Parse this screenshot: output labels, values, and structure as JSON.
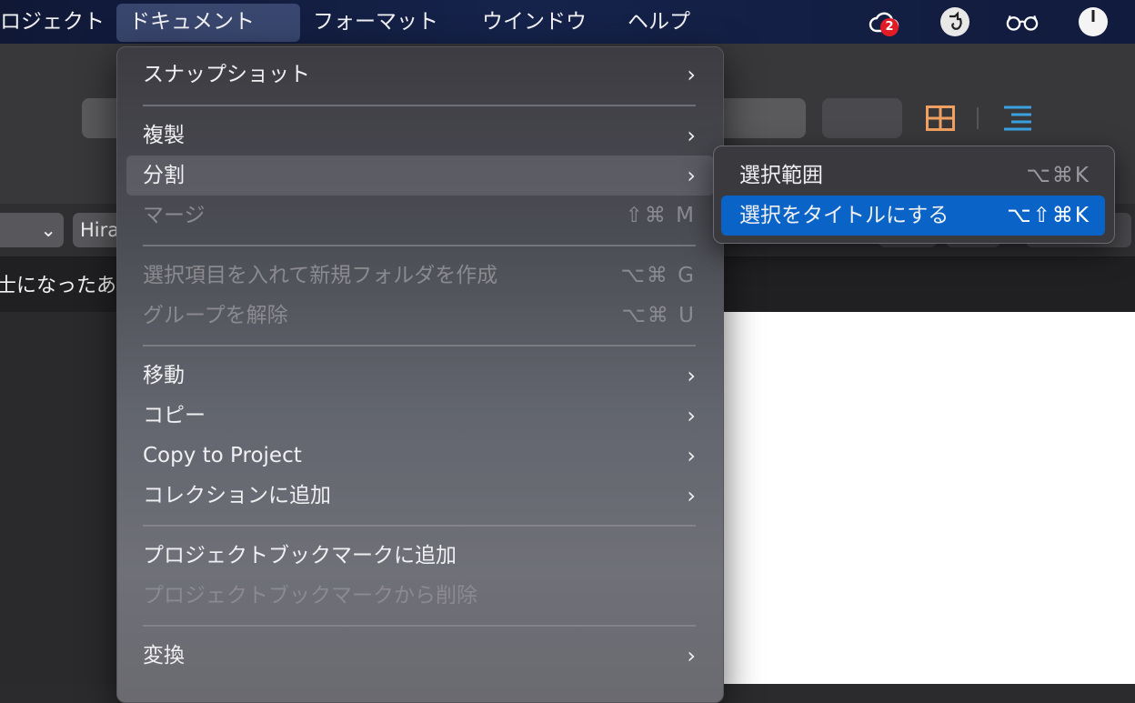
{
  "menubar": {
    "items": [
      "ロジェクト",
      "ドキュメント",
      "フォーマット",
      "ウインドウ",
      "ヘルプ"
    ],
    "active_index": 1,
    "cloud_badge": "2"
  },
  "format_bar": {
    "font_select": "Hira"
  },
  "binder_text": "士になったあ",
  "menu": {
    "snapshot": "スナップショット",
    "duplicate": "複製",
    "split": "分割",
    "merge": "マージ",
    "merge_shortcut": "⇧⌘ M",
    "new_folder": "選択項目を入れて新規フォルダを作成",
    "new_folder_shortcut": "⌥⌘ G",
    "ungroup": "グループを解除",
    "ungroup_shortcut": "⌥⌘ U",
    "move": "移動",
    "copy": "コピー",
    "copy_to_project": "Copy to Project",
    "add_to_collection": "コレクションに追加",
    "add_bookmark": "プロジェクトブックマークに追加",
    "remove_bookmark": "プロジェクトブックマークから削除",
    "convert": "変換",
    "arrow": "›"
  },
  "submenu": {
    "at_selection": "選択範囲",
    "at_selection_shortcut": "⌥⌘K",
    "selection_as_title": "選択をタイトルにする",
    "selection_as_title_shortcut": "⌥⇧⌘K"
  },
  "colors": {
    "accent": "#0a64c8",
    "grid_icon": "#f0a060",
    "outline_icon": "#3aa0e0",
    "badge": "#e21c24"
  }
}
